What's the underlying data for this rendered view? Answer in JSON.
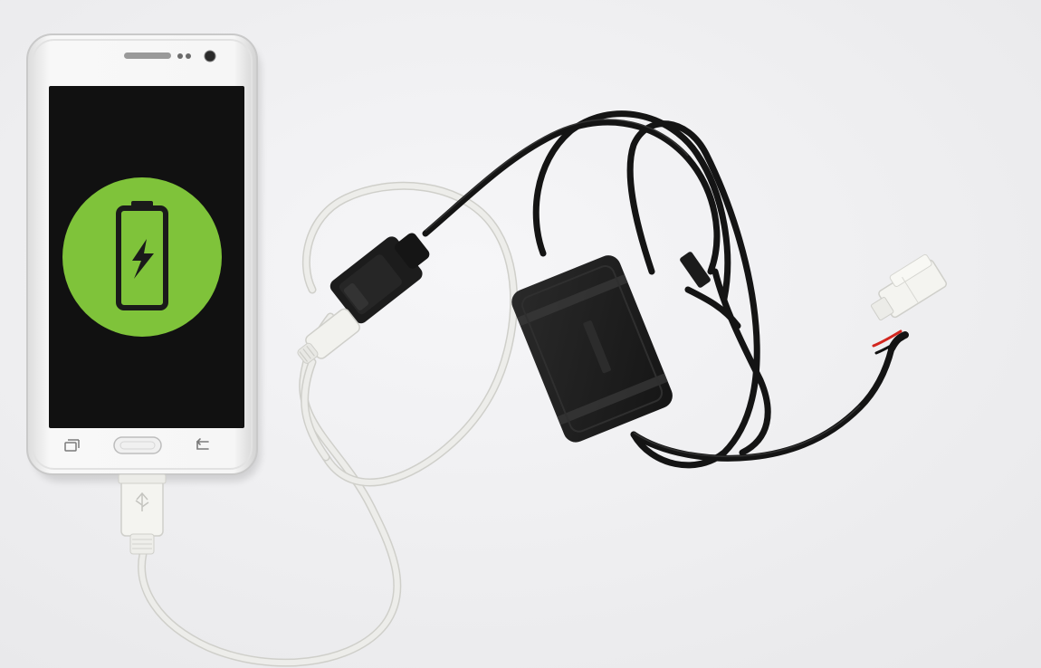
{
  "scene": {
    "colors": {
      "background": "#f1f1f3",
      "phone_body": "#f6f6f6",
      "screen": "#111111",
      "battery_circle": "#7fc33a",
      "white_cable": "#e9e9e5",
      "black_cable": "#141414",
      "connector_housing": "#f4f4f0",
      "red_wire": "#d2261f"
    },
    "icons": [
      "battery-charging-icon",
      "lightning-bolt-icon",
      "recent-apps-icon",
      "home-button",
      "back-icon"
    ]
  }
}
